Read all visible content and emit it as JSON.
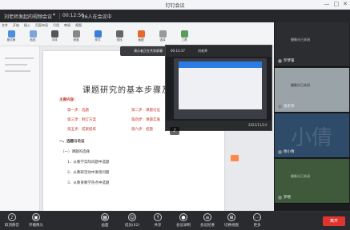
{
  "titlebar": {
    "app_title": "钉钉会议",
    "minimize": "—",
    "maximize": "□",
    "close": "✕"
  },
  "info": {
    "meeting_title": "刘老师发起的视频会议",
    "timer": "00:12:56",
    "participants": "36人在会议中"
  },
  "ribbon": {
    "tabs": [
      "文件",
      "开始",
      "插入",
      "页面布局",
      "引用",
      "审阅",
      "视图"
    ],
    "tools": [
      "格式刷",
      "粘贴",
      "字体",
      "段落",
      "样式",
      "查找",
      "画图",
      "选择",
      "工具"
    ]
  },
  "hint": "演示者正在共享屏幕",
  "doc": {
    "title": "课题研究的基本步骤及要点",
    "section_head": "主要内容：",
    "items": [
      {
        "a": "第一步：选题",
        "b": "第二步：课题论证"
      },
      {
        "a": "第三步：制订方案",
        "b": "第四步：课题实施"
      },
      {
        "a": "第五步：成果提炼",
        "b": "第六步：结题"
      }
    ],
    "part_one": "一、选题与论证",
    "sub_one": "（一）课题的选择",
    "points": [
      "1、从教学实际问题中选题",
      "2、从教研活动中发现问题",
      "3、从教育教学热点中选题"
    ]
  },
  "presenter": {
    "label": "刘老师",
    "time": "00:14:37",
    "date": "2022/11/24"
  },
  "participants": [
    {
      "id": "p1",
      "name": "罗梦嘉",
      "note": "摄像头已关闭",
      "mic": "muted"
    },
    {
      "id": "p2",
      "name": "张老师",
      "note": "摄像头已关闭",
      "mic": "muted"
    },
    {
      "id": "p3",
      "name": "杨小倩",
      "note": "小倩",
      "mic": "muted"
    },
    {
      "id": "p4",
      "name": "罗晓",
      "note": "摄像头已关闭",
      "mic": "muted"
    }
  ],
  "toolbar": {
    "unmute": "取消静音",
    "camera": "开摄像头",
    "layout": "画面",
    "members": "成员(42)",
    "share": "共享",
    "record": "会议录制",
    "minutes": "会议纪要",
    "switch": "切换视图",
    "more": "更多",
    "leave": "离开"
  }
}
